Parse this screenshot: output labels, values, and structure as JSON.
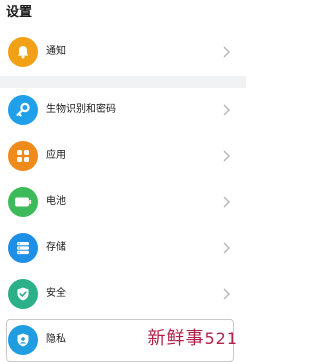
{
  "page": {
    "title": "设置"
  },
  "items": [
    {
      "key": "notifications",
      "label": "通知",
      "icon": "bell-icon",
      "color": "#f2a016"
    },
    {
      "key": "biometrics",
      "label": "生物识别和密码",
      "icon": "key-icon",
      "color": "#1fa0e8"
    },
    {
      "key": "apps",
      "label": "应用",
      "icon": "grid-icon",
      "color": "#f08a1b"
    },
    {
      "key": "battery",
      "label": "电池",
      "icon": "battery-icon",
      "color": "#3dbb5a"
    },
    {
      "key": "storage",
      "label": "存储",
      "icon": "storage-icon",
      "color": "#1f8fe6"
    },
    {
      "key": "security",
      "label": "安全",
      "icon": "shield-check-icon",
      "color": "#2bb08a"
    },
    {
      "key": "privacy",
      "label": "隐私",
      "icon": "privacy-shield-icon",
      "color": "#1f9de0"
    }
  ],
  "watermark": {
    "text": "新鲜事",
    "num": "521",
    "color": "#b0224a"
  }
}
